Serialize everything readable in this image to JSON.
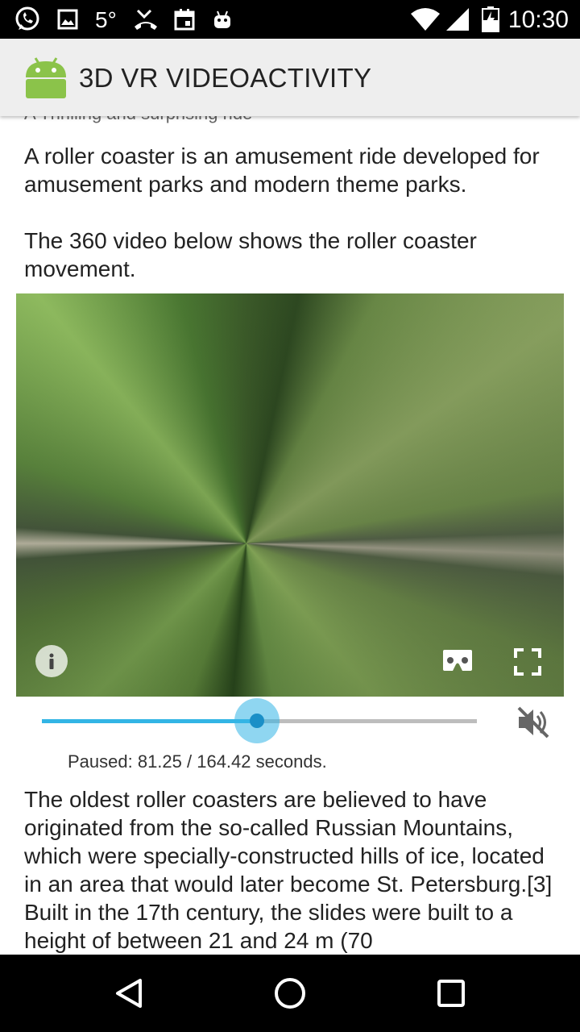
{
  "status_bar": {
    "temperature": "5°",
    "time": "10:30",
    "icons": [
      "whatsapp-icon",
      "image-icon",
      "missed-call-icon",
      "calendar-icon",
      "android-icon",
      "wifi-icon",
      "cell-signal-icon",
      "battery-icon"
    ]
  },
  "action_bar": {
    "title": "3D VR VIDEOACTIVITY",
    "icon": "android-icon",
    "icon_color": "#8bc34a"
  },
  "content": {
    "cut_off_text": "A Thrilling and surprising ride",
    "paragraph1": "A roller coaster is an amusement ride developed for amusement parks and modern theme parks.",
    "paragraph2": "The 360 video below shows the roller coaster movement.",
    "paragraph3": "The oldest roller coasters are believed to have originated from the so-called Russian Mountains, which were specially-constructed hills of ice, located in an area that would later become St. Petersburg.[3] Built in the 17th century, the slides were built to a height of between 21 and 24 m (70"
  },
  "video": {
    "info_icon": "info-icon",
    "vr_icon": "cardboard-vr-icon",
    "fullscreen_icon": "fullscreen-icon"
  },
  "player": {
    "current_seconds": 81.25,
    "total_seconds": 164.42,
    "status_text": "Paused: 81.25 / 164.42 seconds.",
    "mute_icon": "volume-off-icon",
    "accent_color": "#33b5e5"
  },
  "nav_bar": {
    "icons": [
      "back-icon",
      "home-icon",
      "recents-icon"
    ]
  }
}
